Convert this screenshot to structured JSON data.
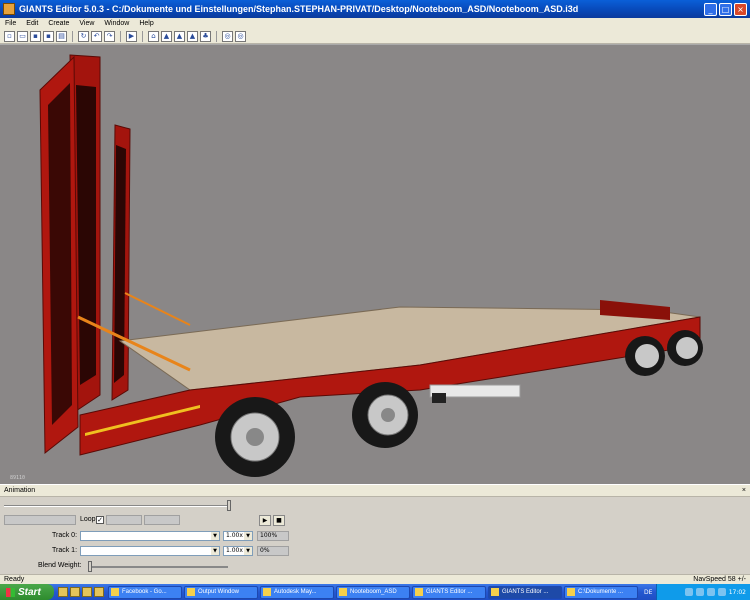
{
  "window": {
    "title": "GIANTS Editor 5.0.3 - C:/Dokumente und Einstellungen/Stephan.STEPHAN-PRIVAT/Desktop/Nooteboom_ASD/Nooteboom_ASD.i3d",
    "minimize": "_",
    "maximize": "□",
    "close": "×"
  },
  "menu": [
    "File",
    "Edit",
    "Create",
    "View",
    "Window",
    "Help"
  ],
  "toolbar": {
    "icons": [
      "new-icon",
      "open-icon",
      "save-icon",
      "save-as-icon",
      "import-icon",
      "refresh-icon",
      "undo-icon",
      "redo-icon",
      "play-icon",
      "home-icon",
      "terrain-icon",
      "terrain-icon",
      "terrain-icon",
      "foliage-icon",
      "select-icon",
      "select-icon"
    ]
  },
  "viewport": {
    "background": "#8a8787",
    "corner_label": "89110",
    "trailer_color": "#b0170f"
  },
  "animation": {
    "title": "Animation",
    "close": "×",
    "loop_label": "Loop",
    "loop_checked": "✓",
    "track0_label": "Track 0:",
    "track0_speed": "1.00x",
    "track0_weight": "100%",
    "track1_label": "Track 1:",
    "track1_speed": "1.00x",
    "track1_weight": "0%",
    "blend_label": "Blend Weight:",
    "play": "▶",
    "stop": "■",
    "arrow": "▼"
  },
  "status": {
    "left": "Ready",
    "right": "NavSpeed 58 +/-"
  },
  "taskbar": {
    "start": "Start",
    "tasks": [
      "Facebook - Go...",
      "Output Window",
      "Autodesk May...",
      "Nooteboom_ASD",
      "GIANTS Editor ...",
      "GIANTS Editor ...",
      "C:\\Dokumente ..."
    ],
    "lang": "DE",
    "clock": "17:02"
  }
}
